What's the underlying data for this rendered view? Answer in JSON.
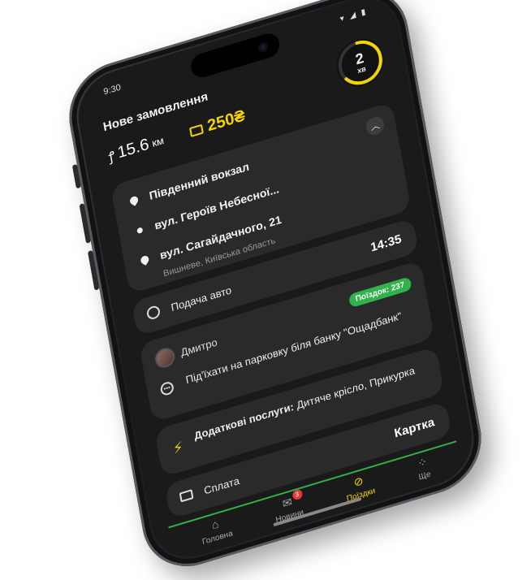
{
  "status": {
    "time": "9:30",
    "icons": "▾ ◢ ▮"
  },
  "header": {
    "title": "Нове замовлення",
    "distance_value": "15.6",
    "distance_unit": "км",
    "price": "250₴",
    "timer_value": "2",
    "timer_unit": "хв",
    "timer_progress": 0.65
  },
  "route": {
    "from": "Південний вокзал",
    "via": "вул. Героїв Небесної...",
    "to": "вул. Сагайдачного, 21",
    "to_sub": "Вишневе, Київська область"
  },
  "pickup": {
    "label": "Подача авто",
    "time": "14:35"
  },
  "comment": {
    "driver": "Дмитро",
    "trips_badge": "Поїздок: 237",
    "message": "Під'їхати на парковку біля банку \"Ощадбанк\""
  },
  "services": {
    "label": "Додаткові послуги:",
    "value": " Дитяче крісло, Прикурка"
  },
  "payment": {
    "label": "Сплата",
    "method": "Картка"
  },
  "tabs": [
    {
      "label": "Головна",
      "icon": "home-icon"
    },
    {
      "label": "Новини",
      "icon": "news-icon",
      "badge": "3"
    },
    {
      "label": "Поїздки",
      "icon": "trips-icon"
    },
    {
      "label": "Ще",
      "icon": "more-icon"
    }
  ],
  "colors": {
    "accent": "#f5d400",
    "green": "#2fb34a",
    "card": "#2a2a2a",
    "screen": "#1a1a1a"
  }
}
